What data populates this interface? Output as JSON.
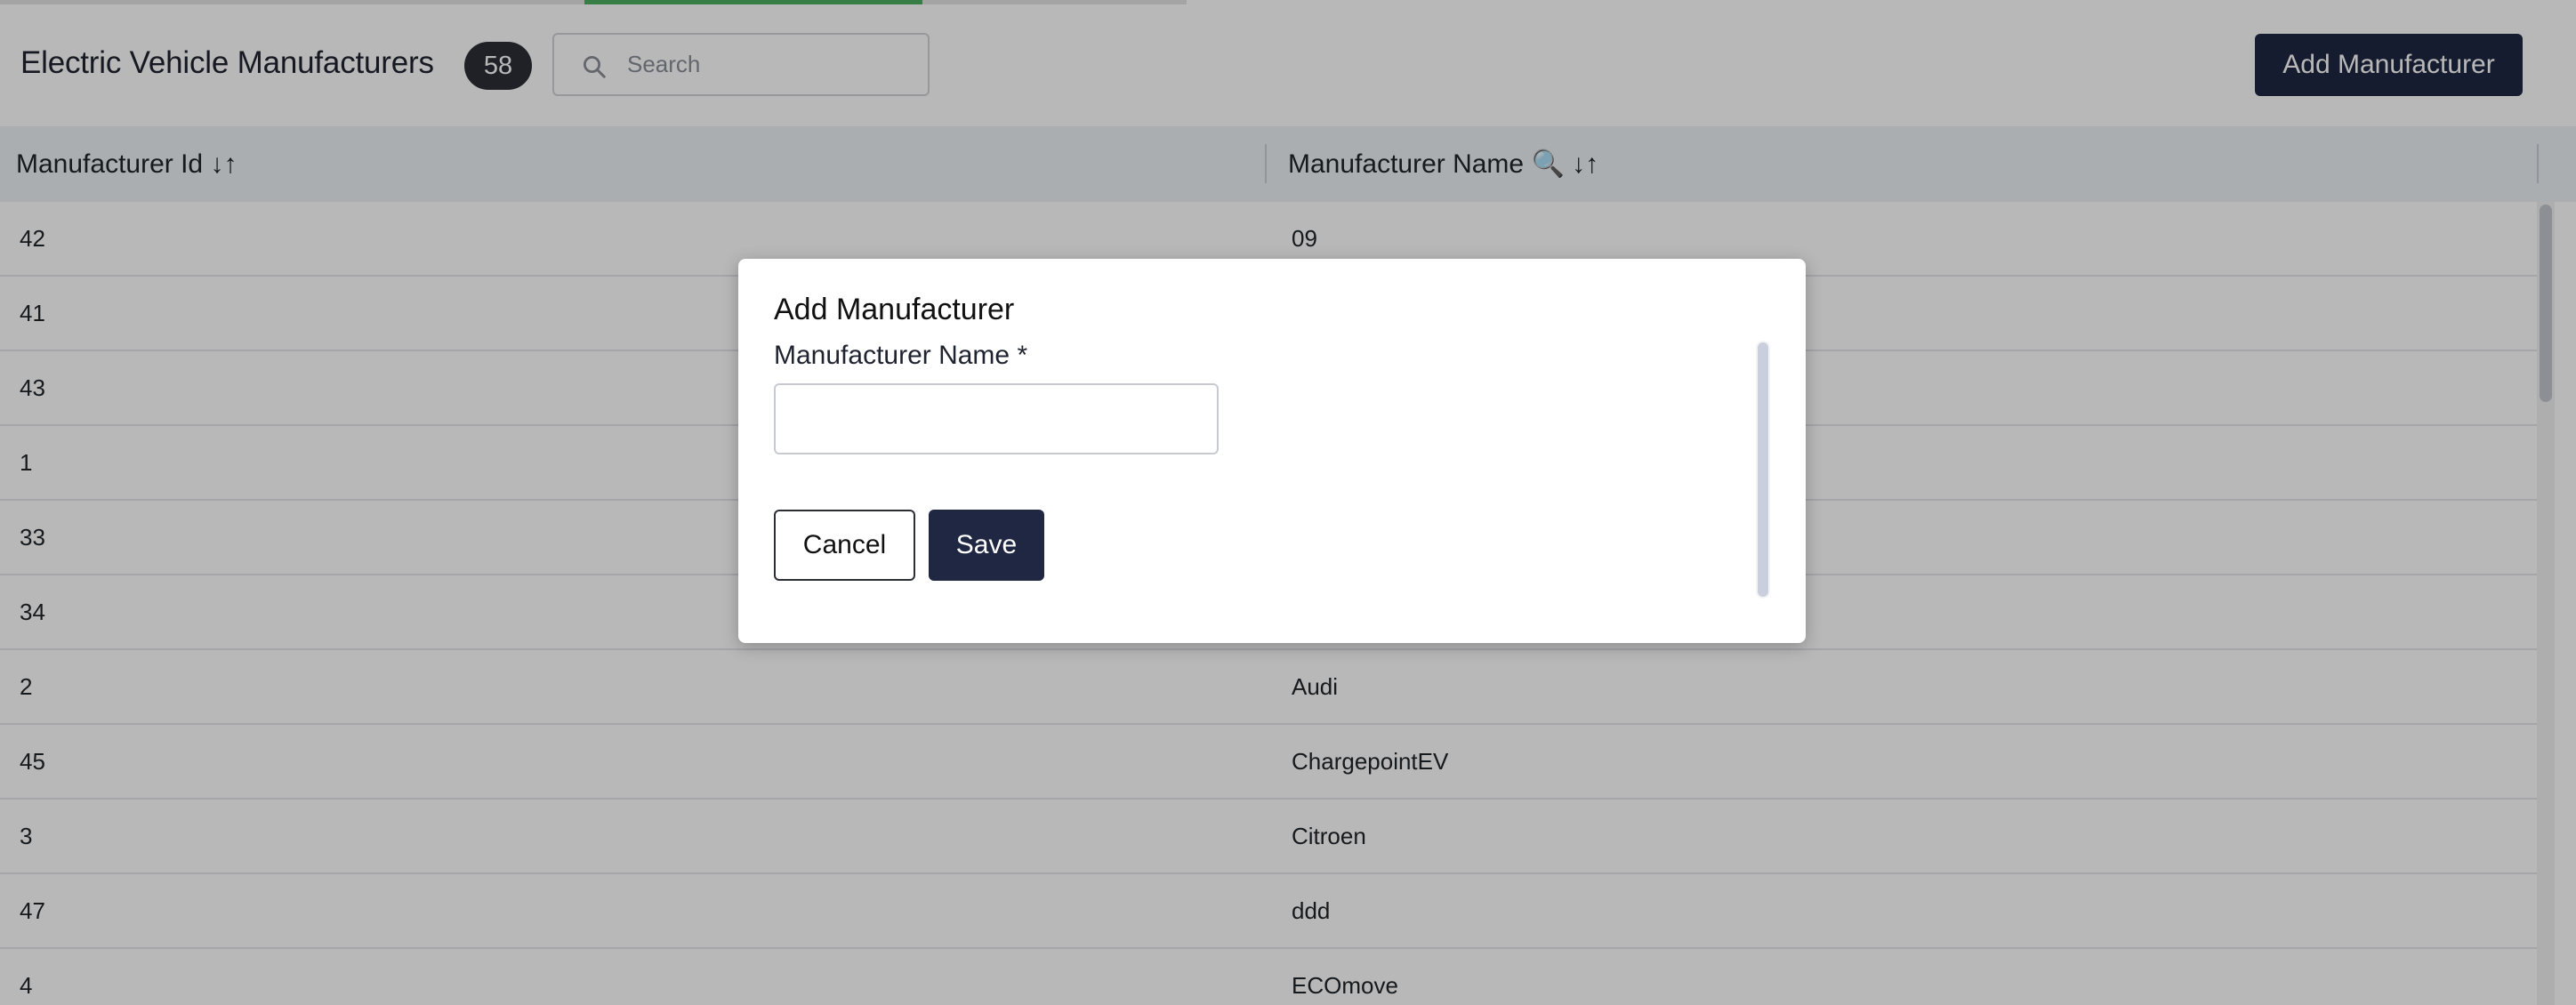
{
  "header": {
    "title": "Electric Vehicle Manufacturers",
    "count": "58",
    "search_placeholder": "Search",
    "add_button": "Add Manufacturer"
  },
  "table": {
    "columns": {
      "id": "Manufacturer Id ↓↑",
      "name": "Manufacturer Name 🔍 ↓↑"
    },
    "rows": [
      {
        "id": "42",
        "name": "09"
      },
      {
        "id": "41",
        "name": ""
      },
      {
        "id": "43",
        "name": ""
      },
      {
        "id": "1",
        "name": ""
      },
      {
        "id": "33",
        "name": ""
      },
      {
        "id": "34",
        "name": ""
      },
      {
        "id": "2",
        "name": "Audi"
      },
      {
        "id": "45",
        "name": "ChargepointEV"
      },
      {
        "id": "3",
        "name": "Citroen"
      },
      {
        "id": "47",
        "name": "ddd"
      },
      {
        "id": "4",
        "name": "ECOmove"
      }
    ]
  },
  "modal": {
    "title": "Add Manufacturer",
    "field_label": "Manufacturer Name *",
    "field_value": "",
    "cancel": "Cancel",
    "save": "Save"
  },
  "colors": {
    "primary": "#1f2742",
    "badge": "#2b2e35",
    "progress": "#4caf62",
    "header_row": "#eef1f6"
  },
  "icons": {
    "search": "search-icon"
  }
}
